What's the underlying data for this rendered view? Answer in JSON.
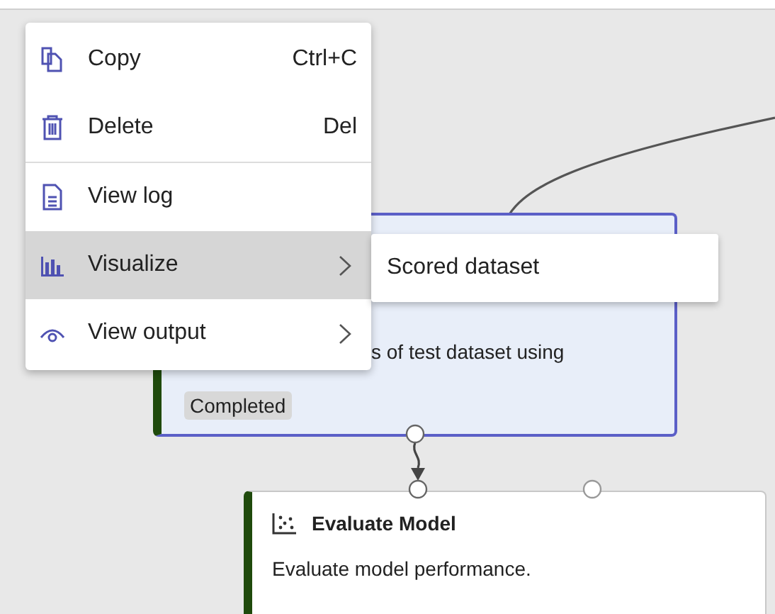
{
  "context_menu": {
    "items": [
      {
        "kind": "copy",
        "label": "Copy",
        "shortcut": "Ctrl+C",
        "has_submenu": false,
        "selected": false,
        "separator_after": false
      },
      {
        "kind": "delete",
        "label": "Delete",
        "shortcut": "Del",
        "has_submenu": false,
        "selected": false,
        "separator_after": true
      },
      {
        "kind": "log",
        "label": "View log",
        "has_submenu": false,
        "selected": false,
        "separator_after": false
      },
      {
        "kind": "visualize",
        "label": "Visualize",
        "has_submenu": true,
        "selected": true,
        "separator_after": false
      },
      {
        "kind": "output",
        "label": "View output",
        "has_submenu": true,
        "selected": false,
        "separator_after": false
      }
    ]
  },
  "submenu": {
    "items": [
      "Scored dataset"
    ]
  },
  "nodes": [
    {
      "description": "s of test dataset using",
      "status": "Completed",
      "selected": true
    },
    {
      "title": "Evaluate Model",
      "description": "Evaluate model performance.",
      "selected": false
    }
  ]
}
